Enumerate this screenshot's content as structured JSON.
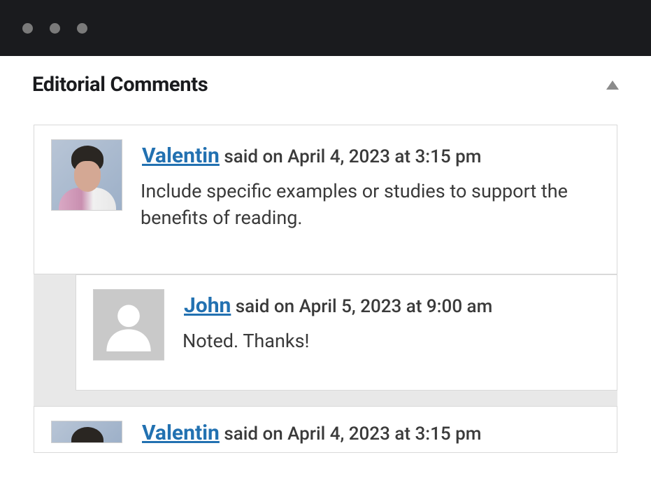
{
  "panel": {
    "title": "Editorial Comments"
  },
  "comments": [
    {
      "author": "Valentin",
      "said_prefix": "said on",
      "timestamp": "April 4, 2023 at 3:15 pm",
      "text": " Include specific examples or studies to support the benefits of reading."
    },
    {
      "author": "John",
      "said_prefix": "said on",
      "timestamp": "April 5, 2023 at 9:00 am",
      "text": "Noted. Thanks!"
    },
    {
      "author": "Valentin",
      "said_prefix": "said on",
      "timestamp": "April 4, 2023 at 3:15 pm",
      "text": ""
    }
  ]
}
